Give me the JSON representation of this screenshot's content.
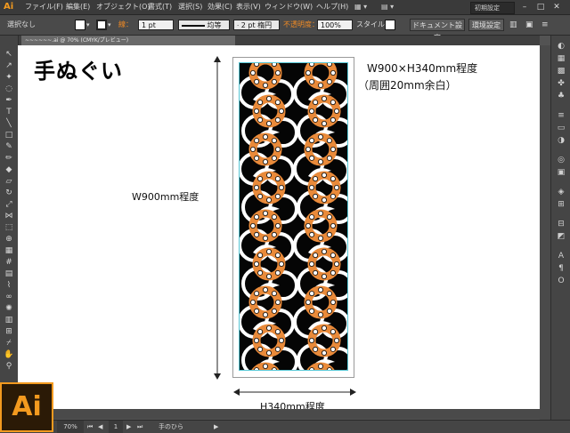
{
  "app": {
    "logo_text": "Ai",
    "workspace": "初期設定",
    "menu": [
      "ファイル(F)",
      "編集(E)",
      "オブジェクト(O)",
      "書式(T)",
      "選択(S)",
      "効果(C)",
      "表示(V)",
      "ウィンドウ(W)",
      "ヘルプ(H)"
    ]
  },
  "controlbar": {
    "selection_status": "選択なし",
    "stroke_label": "線：",
    "stroke_weight": "1 pt",
    "brush_profile": "均等",
    "brush_def": "2 pt 楕円",
    "opacity_label": "不透明度：",
    "opacity_value": "100%",
    "style_label": "スタイル：",
    "doc_setup_button": "ドキュメント設定",
    "prefs_button": "環境設定"
  },
  "document": {
    "tab_title": "~~~~~~.ai @ 70% (CMYK/プレビュー)",
    "title": "手ぬぐい",
    "size_note_line1": "W900×H340mm程度",
    "size_note_line2": "（周囲20mm余白）",
    "height_label": "W900mm程度",
    "width_label": "H340mm程度"
  },
  "status": {
    "zoom": "70%",
    "page": "1",
    "tool_name": "手のひら"
  },
  "colors": {
    "accent": "#f39a1f",
    "pattern_orange": "#e98a3a",
    "pattern_black": "#050505"
  }
}
